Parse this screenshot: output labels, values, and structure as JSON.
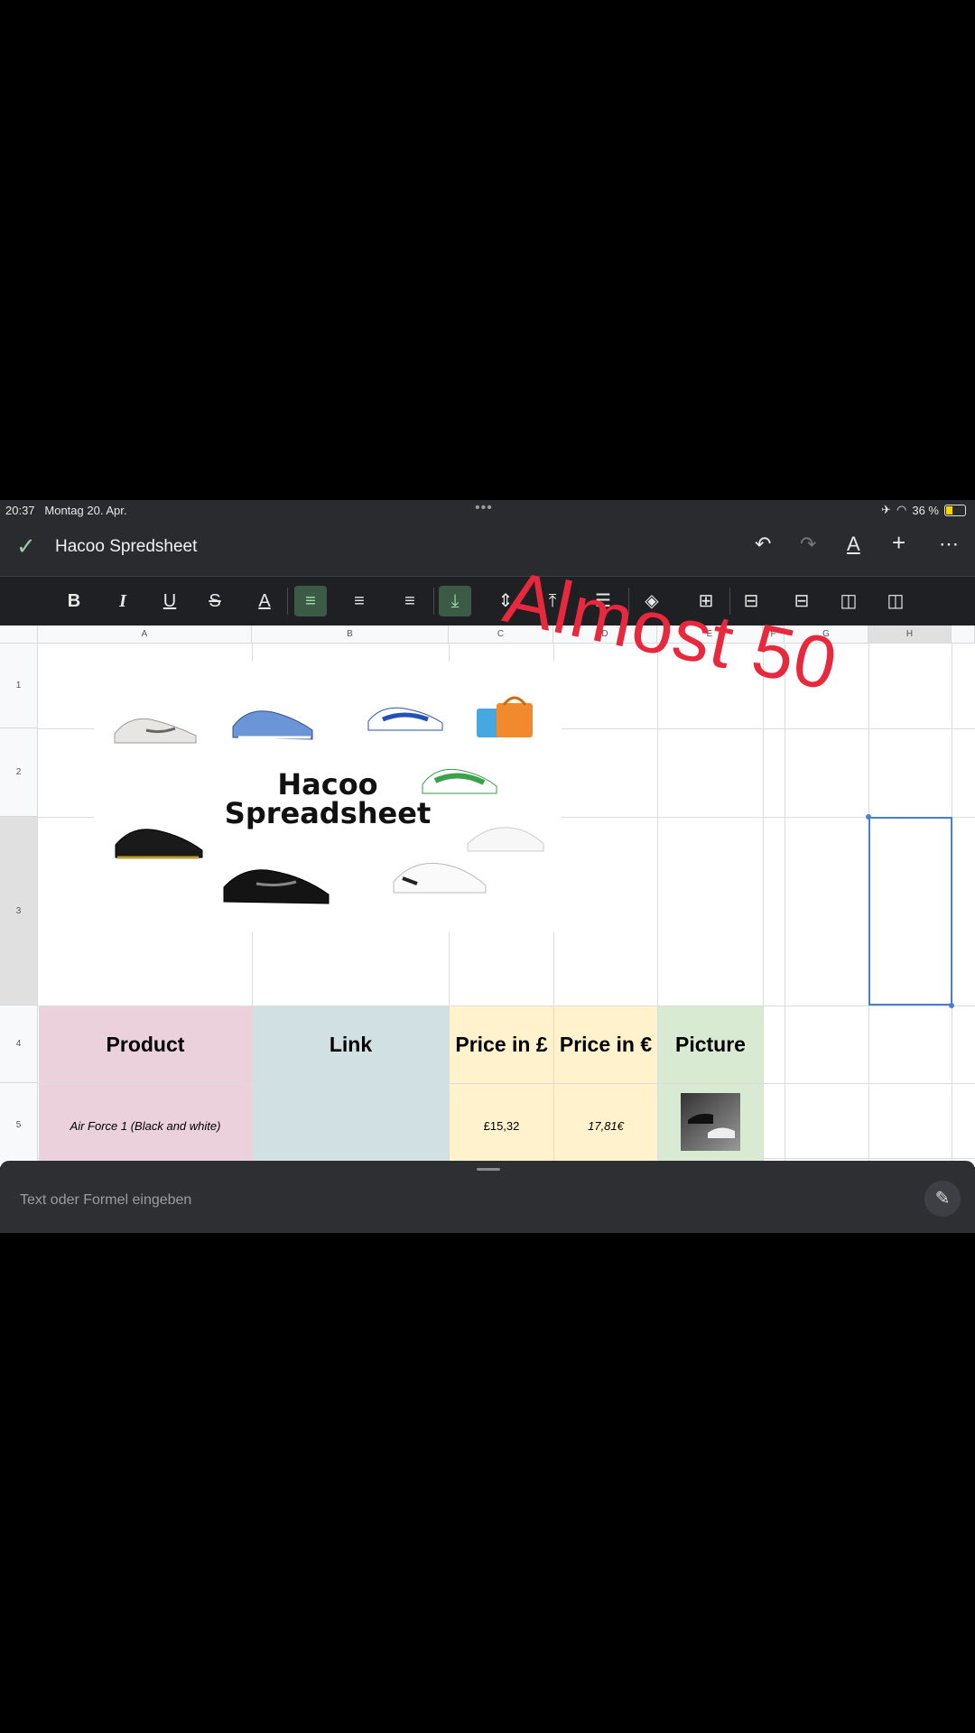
{
  "status": {
    "time": "20:37",
    "date": "Montag 20. Apr.",
    "battery": "36 %",
    "battery_level": 0.36
  },
  "header": {
    "title": "Hacoo Spredsheet"
  },
  "columns": [
    "A",
    "B",
    "C",
    "D",
    "E",
    "F",
    "G",
    "H"
  ],
  "rows": [
    "1",
    "2",
    "3",
    "4",
    "5"
  ],
  "banner": {
    "line1": "Hacoo",
    "line2": "Spreadsheet"
  },
  "table": {
    "headers": [
      "Product",
      "Link",
      "Price in £",
      "Price in €",
      "Picture"
    ],
    "row5": {
      "product": "Air Force 1 (Black and white)",
      "link": "",
      "price_gbp": "£15,32",
      "price_eur": "17,81€"
    }
  },
  "overlay_text": "Almost 50",
  "formula_bar": {
    "placeholder": "Text oder Formel eingeben"
  },
  "colors": {
    "product_bg": "#ead1dc",
    "link_bg": "#d0e0e3",
    "price_bg": "#fff2cc",
    "picture_bg": "#d9ead3",
    "overlay": "#e8283c",
    "selection": "#4a7fd0"
  }
}
